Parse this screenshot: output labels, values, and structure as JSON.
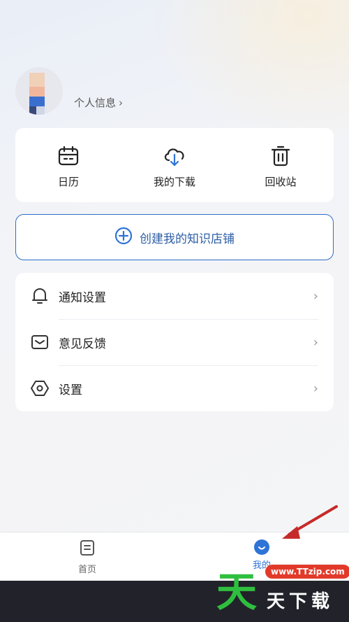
{
  "profile": {
    "link_label": "个人信息"
  },
  "quick_actions": [
    {
      "label": "日历",
      "icon": "calendar-icon"
    },
    {
      "label": "我的下载",
      "icon": "cloud-download-icon"
    },
    {
      "label": "回收站",
      "icon": "trash-icon"
    }
  ],
  "create_store": {
    "label": "创建我的知识店铺",
    "icon": "plus-circle-icon"
  },
  "menu": [
    {
      "label": "通知设置",
      "icon": "bell-icon"
    },
    {
      "label": "意见反馈",
      "icon": "mail-icon"
    },
    {
      "label": "设置",
      "icon": "hexagon-gear-icon"
    }
  ],
  "tabbar": {
    "home_label": "首页",
    "mine_label": "我的"
  },
  "watermark": {
    "logo": "天",
    "url": "www.TTzip.com",
    "text": "天下载"
  },
  "colors": {
    "accent": "#2e74d6",
    "create_border": "#2d6dc6",
    "watermark_green": "#2fbf3f",
    "watermark_red": "#e23a2a",
    "annotation_arrow": "#c62b2b"
  }
}
